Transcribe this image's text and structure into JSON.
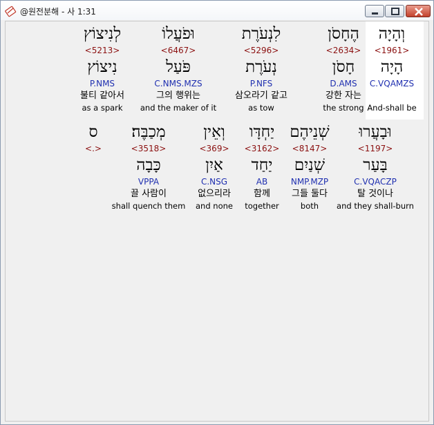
{
  "window": {
    "title": "@원전분해 - 사 1:31",
    "icon": "bible-book-icon"
  },
  "rows": [
    [
      {
        "heb": "וְהָיָה",
        "strong": "<1961>",
        "lemma": "הָיָה",
        "morph": "C.VQAMZS",
        "kor": "",
        "eng": "And-shall be",
        "highlighted": true
      },
      {
        "heb": "הֶחָסֹן",
        "strong": "<2634>",
        "lemma": "חָסֹן",
        "morph": "D.AMS",
        "kor": "강한 자는",
        "eng": "the strong"
      },
      {
        "heb": "לִנְעֹרֶת",
        "strong": "<5296>",
        "lemma": "נְעֹרֶת",
        "morph": "P.NFS",
        "kor": "삼오라기 같고",
        "eng": "as tow"
      },
      {
        "heb": "וּפֹעֲלוֹ",
        "strong": "<6467>",
        "lemma": "פֹּעַל",
        "morph": "C.NMS.MZS",
        "kor": "그의 행위는",
        "eng": "and the maker of it"
      },
      {
        "heb": "לְנִיצוֹץ",
        "strong": "<5213>",
        "lemma": "נִיצוֹץ",
        "morph": "P.NMS",
        "kor": "불티 같아서",
        "eng": "as a spark"
      }
    ],
    [
      {
        "heb": "וּבָעֲרוּ",
        "strong": "<1197>",
        "lemma": "בָּעַר",
        "morph": "C.VQACZP",
        "kor": "탈 것이나",
        "eng": "and they shall-burn"
      },
      {
        "heb": "שְׁנֵיהֶם",
        "strong": "<8147>",
        "lemma": "שְׁנַיִם",
        "morph": "NMP.MZP",
        "kor": "그들 둘다",
        "eng": "both"
      },
      {
        "heb": "יַחְדָּו",
        "strong": "<3162>",
        "lemma": "יַחַד",
        "morph": "AB",
        "kor": "함께",
        "eng": "together"
      },
      {
        "heb": "וְאֵין",
        "strong": "<369>",
        "lemma": "אַיִן",
        "morph": "C.NSG",
        "kor": "없으리라",
        "eng": "and none"
      },
      {
        "heb": "מְכַבֶּה׃",
        "strong": "<3518>",
        "lemma": "כָּבָה",
        "morph": "VPPA",
        "kor": "끌 사람이",
        "eng": "shall quench them"
      },
      {
        "heb": "ס",
        "strong": "<.>",
        "lemma": "",
        "morph": "",
        "kor": "",
        "eng": ""
      }
    ]
  ]
}
